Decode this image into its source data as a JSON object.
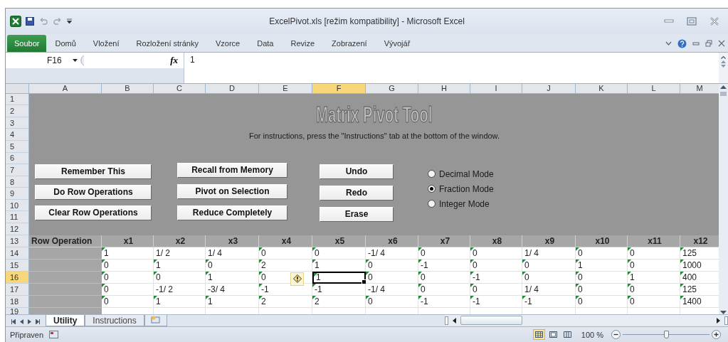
{
  "window": {
    "title": "ExcelPivot.xls  [režim kompatibility] - Microsoft Excel"
  },
  "ribbon_tabs": [
    {
      "label": "Soubor",
      "kind": "file"
    },
    {
      "label": "Domů",
      "kind": "tab"
    },
    {
      "label": "Vložení",
      "kind": "tab"
    },
    {
      "label": "Rozložení stránky",
      "kind": "tab"
    },
    {
      "label": "Vzorce",
      "kind": "tab"
    },
    {
      "label": "Data",
      "kind": "tab"
    },
    {
      "label": "Revize",
      "kind": "tab"
    },
    {
      "label": "Zobrazení",
      "kind": "tab"
    },
    {
      "label": "Vývojář",
      "kind": "tab"
    }
  ],
  "formula_bar": {
    "name_box": "F16",
    "function_button": "fx",
    "value": "1"
  },
  "columns": [
    {
      "label": "A",
      "selected": false
    },
    {
      "label": "B",
      "selected": false
    },
    {
      "label": "C",
      "selected": false
    },
    {
      "label": "D",
      "selected": false
    },
    {
      "label": "E",
      "selected": false
    },
    {
      "label": "F",
      "selected": true
    },
    {
      "label": "G",
      "selected": false
    },
    {
      "label": "H",
      "selected": false
    },
    {
      "label": "I",
      "selected": false
    },
    {
      "label": "J",
      "selected": false
    },
    {
      "label": "K",
      "selected": false
    },
    {
      "label": "L",
      "selected": false
    },
    {
      "label": "M",
      "selected": false
    }
  ],
  "row_headers": [
    {
      "label": "1",
      "selected": false
    },
    {
      "label": "2",
      "selected": false
    },
    {
      "label": "3",
      "selected": false
    },
    {
      "label": "4",
      "selected": false
    },
    {
      "label": "5",
      "selected": false
    },
    {
      "label": "6",
      "selected": false
    },
    {
      "label": "7",
      "selected": false
    },
    {
      "label": "8",
      "selected": false
    },
    {
      "label": "9",
      "selected": false
    },
    {
      "label": "10",
      "selected": false
    },
    {
      "label": "11",
      "selected": false
    },
    {
      "label": "12",
      "selected": false
    },
    {
      "label": "13",
      "selected": false
    },
    {
      "label": "14",
      "selected": false
    },
    {
      "label": "15",
      "selected": false
    },
    {
      "label": "16",
      "selected": true
    },
    {
      "label": "17",
      "selected": false
    },
    {
      "label": "18",
      "selected": false
    },
    {
      "label": "19",
      "selected": false
    }
  ],
  "panel": {
    "title": "Matrix Pivot Tool",
    "instructions": "For instructions, press the \"Instructions\" tab at the bottom of the window.",
    "button_columns": [
      [
        "Remember This",
        "Do Row Operations",
        "Clear Row Operations"
      ],
      [
        "Recall from Memory",
        "Pivot on Selection",
        "Reduce Completely"
      ],
      [
        "Undo",
        "Redo",
        "Erase"
      ]
    ],
    "modes": [
      {
        "label": "Decimal Mode",
        "selected": false
      },
      {
        "label": "Fraction Mode",
        "selected": true
      },
      {
        "label": "Integer Mode",
        "selected": false
      }
    ]
  },
  "table": {
    "headings": [
      "Row Operation",
      "x1",
      "x2",
      "x3",
      "x4",
      "x5",
      "x6",
      "x7",
      "x8",
      "x9",
      "x10",
      "x11",
      "x12"
    ],
    "rows": [
      [
        {
          "value": "1",
          "flagged": true,
          "selected": false
        },
        {
          "value": "1/ 2",
          "flagged": false,
          "selected": false
        },
        {
          "value": "1/ 4",
          "flagged": false,
          "selected": false
        },
        {
          "value": "0",
          "flagged": true,
          "selected": false
        },
        {
          "value": "0",
          "flagged": true,
          "selected": false
        },
        {
          "value": "-1/ 4",
          "flagged": false,
          "selected": false
        },
        {
          "value": "0",
          "flagged": true,
          "selected": false
        },
        {
          "value": "0",
          "flagged": true,
          "selected": false
        },
        {
          "value": "1/ 4",
          "flagged": false,
          "selected": false
        },
        {
          "value": "0",
          "flagged": true,
          "selected": false
        },
        {
          "value": "0",
          "flagged": true,
          "selected": false
        },
        {
          "value": "125",
          "flagged": true,
          "selected": false
        }
      ],
      [
        {
          "value": "0",
          "flagged": true,
          "selected": false
        },
        {
          "value": "1",
          "flagged": true,
          "selected": false
        },
        {
          "value": "0",
          "flagged": true,
          "selected": false
        },
        {
          "value": "2",
          "flagged": true,
          "selected": false
        },
        {
          "value": "1",
          "flagged": true,
          "selected": false
        },
        {
          "value": "0",
          "flagged": true,
          "selected": false
        },
        {
          "value": "-1",
          "flagged": true,
          "selected": false
        },
        {
          "value": "0",
          "flagged": true,
          "selected": false
        },
        {
          "value": "0",
          "flagged": true,
          "selected": false
        },
        {
          "value": "1",
          "flagged": true,
          "selected": false
        },
        {
          "value": "0",
          "flagged": true,
          "selected": false
        },
        {
          "value": "1000",
          "flagged": true,
          "selected": false
        }
      ],
      [
        {
          "value": "0",
          "flagged": true,
          "selected": false
        },
        {
          "value": "0",
          "flagged": true,
          "selected": false
        },
        {
          "value": "1",
          "flagged": true,
          "selected": false
        },
        {
          "value": "0",
          "flagged": true,
          "selected": false
        },
        {
          "value": "1",
          "flagged": true,
          "selected": true
        },
        {
          "value": "0",
          "flagged": true,
          "selected": false
        },
        {
          "value": "0",
          "flagged": true,
          "selected": false
        },
        {
          "value": "-1",
          "flagged": true,
          "selected": false
        },
        {
          "value": "0",
          "flagged": true,
          "selected": false
        },
        {
          "value": "0",
          "flagged": true,
          "selected": false
        },
        {
          "value": "1",
          "flagged": true,
          "selected": false
        },
        {
          "value": "400",
          "flagged": true,
          "selected": false
        }
      ],
      [
        {
          "value": "0",
          "flagged": true,
          "selected": false
        },
        {
          "value": "-1/ 2",
          "flagged": false,
          "selected": false
        },
        {
          "value": "-3/ 4",
          "flagged": false,
          "selected": false
        },
        {
          "value": "-1",
          "flagged": true,
          "selected": false
        },
        {
          "value": "-1",
          "flagged": true,
          "selected": false
        },
        {
          "value": "-1/ 4",
          "flagged": false,
          "selected": false
        },
        {
          "value": "0",
          "flagged": true,
          "selected": false
        },
        {
          "value": "0",
          "flagged": true,
          "selected": false
        },
        {
          "value": "1/ 4",
          "flagged": false,
          "selected": false
        },
        {
          "value": "0",
          "flagged": true,
          "selected": false
        },
        {
          "value": "0",
          "flagged": true,
          "selected": false
        },
        {
          "value": "125",
          "flagged": true,
          "selected": false
        }
      ],
      [
        {
          "value": "0",
          "flagged": true,
          "selected": false
        },
        {
          "value": "1",
          "flagged": true,
          "selected": false
        },
        {
          "value": "1",
          "flagged": true,
          "selected": false
        },
        {
          "value": "2",
          "flagged": true,
          "selected": false
        },
        {
          "value": "2",
          "flagged": true,
          "selected": false
        },
        {
          "value": "0",
          "flagged": true,
          "selected": false
        },
        {
          "value": "-1",
          "flagged": true,
          "selected": false
        },
        {
          "value": "-1",
          "flagged": true,
          "selected": false
        },
        {
          "value": "-1",
          "flagged": true,
          "selected": false
        },
        {
          "value": "0",
          "flagged": true,
          "selected": false
        },
        {
          "value": "0",
          "flagged": true,
          "selected": false
        },
        {
          "value": "1400",
          "flagged": true,
          "selected": false
        }
      ]
    ]
  },
  "sheet_tabs": [
    {
      "label": "Utility",
      "selected": true
    },
    {
      "label": "Instructions",
      "selected": false
    }
  ],
  "status_bar": {
    "status": "Připraven",
    "views": [
      {
        "kind": "normal",
        "selected": true
      },
      {
        "kind": "page_layout",
        "selected": false
      },
      {
        "kind": "page_break",
        "selected": false
      }
    ],
    "zoom": {
      "reading": "100 %",
      "level": 0.5
    }
  }
}
